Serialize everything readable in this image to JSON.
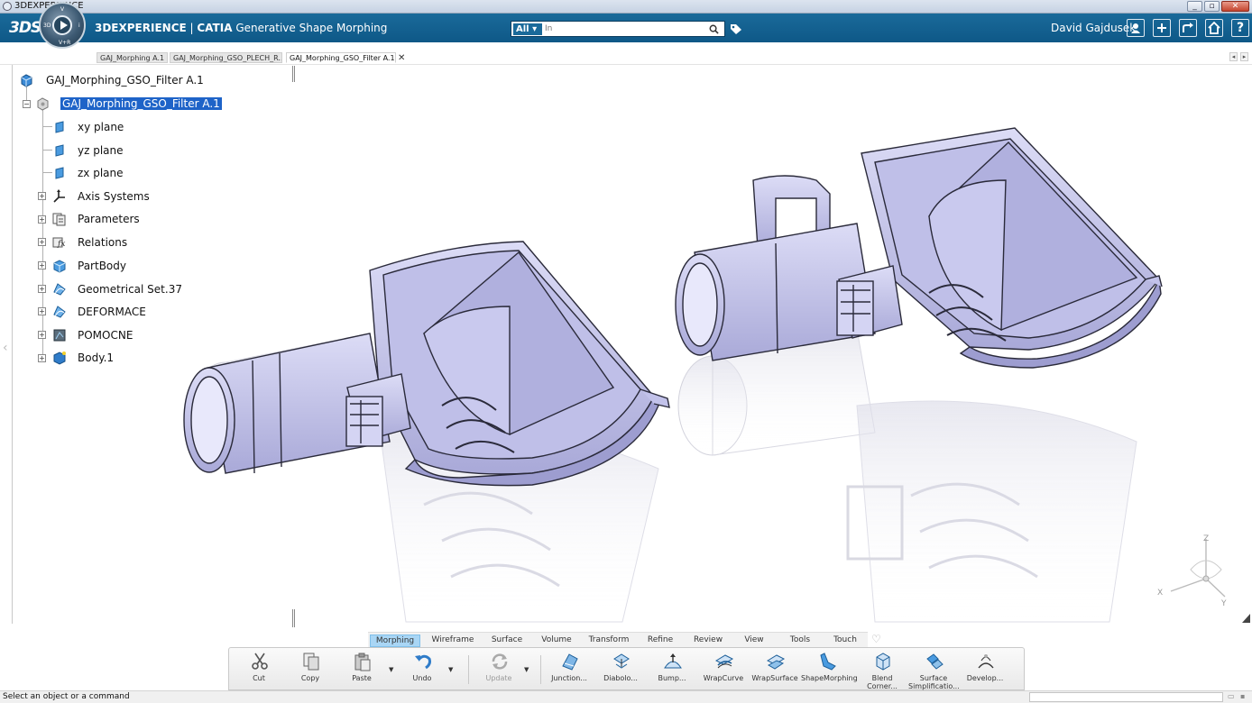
{
  "os": {
    "title": "3DEXPERIENCE",
    "min": "_",
    "restore": "▫",
    "close": "✕"
  },
  "header": {
    "compass_quadrants": [
      "3D",
      "V",
      "i",
      "V+R"
    ],
    "brand": "3DEXPERIENCE",
    "product": "CATIA",
    "app": "Generative Shape Morphing",
    "search_scope": "All",
    "search_placeholder": "In",
    "user": "David Gajdusek",
    "accent": "#0e5887"
  },
  "tabs": [
    {
      "label": "GAJ_Morphing A.1"
    },
    {
      "label": "GAJ_Morphing_GSO_PLECH_R..."
    },
    {
      "label": "GAJ_Morphing_GSO_Filter A.1"
    }
  ],
  "tree": {
    "root": "GAJ_Morphing_GSO_Filter A.1",
    "part": "GAJ_Morphing_GSO_Filter A.1",
    "items": [
      {
        "label": "xy plane",
        "icon": "plane-icon"
      },
      {
        "label": "yz plane",
        "icon": "plane-icon"
      },
      {
        "label": "zx plane",
        "icon": "plane-icon"
      },
      {
        "label": "Axis Systems",
        "icon": "axis-systems-icon"
      },
      {
        "label": "Parameters",
        "icon": "parameters-icon"
      },
      {
        "label": "Relations",
        "icon": "relations-icon"
      },
      {
        "label": "PartBody",
        "icon": "partbody-icon"
      },
      {
        "label": "Geometrical Set.37",
        "icon": "geometrical-set-icon"
      },
      {
        "label": "DEFORMACE",
        "icon": "geometrical-set-icon"
      },
      {
        "label": "POMOCNE",
        "icon": "geometrical-set-icon"
      },
      {
        "label": "Body.1",
        "icon": "body-icon"
      }
    ]
  },
  "viewport": {
    "compass_axes": {
      "x": "X",
      "y": "Y",
      "z": "Z"
    },
    "part_color": "#c9c9ee"
  },
  "section_tabs": [
    "Morphing",
    "Wireframe",
    "Surface",
    "Volume",
    "Transform",
    "Refine",
    "Review",
    "View",
    "Tools",
    "Touch"
  ],
  "active_section": "Morphing",
  "commands": [
    {
      "label": "Cut",
      "icon": "scissors-icon"
    },
    {
      "label": "Copy",
      "icon": "copy-icon"
    },
    {
      "label": "Paste",
      "icon": "paste-icon"
    },
    {
      "label": "Undo",
      "icon": "undo-icon"
    },
    {
      "label": "Update",
      "icon": "update-icon"
    },
    {
      "label": "Junction...",
      "icon": "junction-icon"
    },
    {
      "label": "Diabolo...",
      "icon": "diabolo-icon"
    },
    {
      "label": "Bump...",
      "icon": "bump-icon"
    },
    {
      "label": "WrapCurve",
      "icon": "wrapcurve-icon"
    },
    {
      "label": "WrapSurface",
      "icon": "wrapsurface-icon"
    },
    {
      "label": "ShapeMorphing",
      "icon": "shapemorphing-icon"
    },
    {
      "label": "Blend Corner...",
      "icon": "blend-corner-icon"
    },
    {
      "label": "Surface Simplificatio...",
      "icon": "surface-simplification-icon"
    },
    {
      "label": "Develop...",
      "icon": "develop-icon"
    }
  ],
  "status": {
    "message": "Select an object or a command"
  }
}
